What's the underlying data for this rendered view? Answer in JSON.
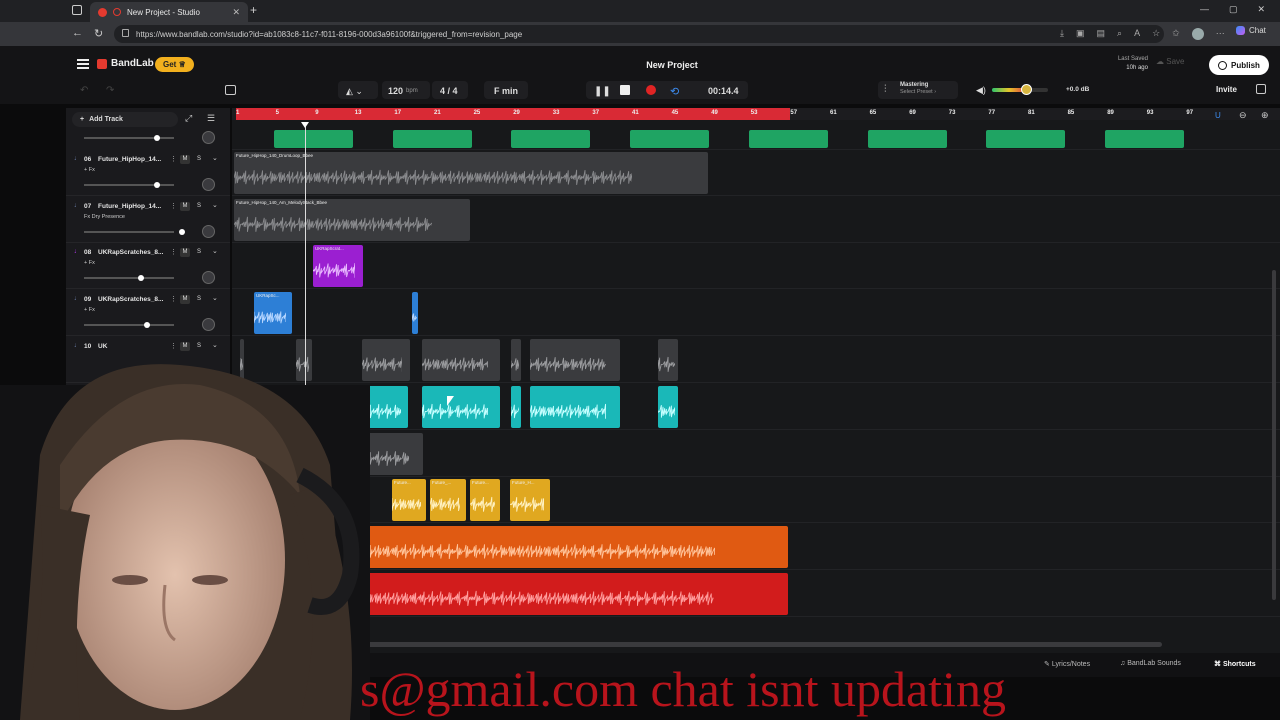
{
  "browser": {
    "tab_title": "New Project - Studio",
    "url": "https://www.bandlab.com/studio?id=ab1083c8-11c7-f011-8196-000d3a96100f&triggered_from=revision_page",
    "chat_label": "Chat"
  },
  "header": {
    "logo": "BandLab",
    "get_button": "Get",
    "project_title": "New Project",
    "last_saved_label": "Last Saved",
    "last_saved_time": "10h ago",
    "save_label": "Save",
    "publish_label": "Publish",
    "invite_label": "Invite"
  },
  "transport": {
    "bpm": "120",
    "bpm_unit": "bpm",
    "time_signature": "4 / 4",
    "key": "F min",
    "time": "00:14.4",
    "mastering_label": "Mastering",
    "mastering_preset": "Select Preset",
    "master_volume": "+0.0 dB",
    "volume_level": 0.6
  },
  "track_panel": {
    "add_track_label": "Add Track",
    "tracks": [
      {
        "number": "06",
        "name": "Future_HipHop_14...",
        "fx": "+ Fx",
        "mute": "M",
        "solo": "S"
      },
      {
        "number": "07",
        "name": "Future_HipHop_14...",
        "fx": "Fx Dry Presence",
        "mute": "M",
        "solo": "S"
      },
      {
        "number": "08",
        "name": "UKRapScratches_8...",
        "fx": "+ Fx",
        "mute": "M",
        "solo": "S"
      },
      {
        "number": "09",
        "name": "UKRapScratches_8...",
        "fx": "+ Fx",
        "mute": "M",
        "solo": "S"
      },
      {
        "number": "10",
        "name": "UK",
        "fx": "",
        "mute": "M",
        "solo": "S"
      }
    ]
  },
  "ruler": {
    "ticks": [
      "1",
      "5",
      "9",
      "13",
      "17",
      "21",
      "25",
      "29",
      "33",
      "37",
      "41",
      "45",
      "49",
      "53",
      "57",
      "61",
      "65",
      "69",
      "73",
      "77",
      "81",
      "85",
      "89",
      "93",
      "97"
    ]
  },
  "clips": {
    "lane1_name": "Future_HipHop_140_DrumLoop_Bbee",
    "lane2_name": "Future_HipHop_140_Am_MelodyStack_Bbee",
    "lane3_name": "UKRapScrat...",
    "lane4_name": "UKRapSc...",
    "lane8_names": [
      "Future...",
      "Future_...",
      "Future...",
      "Future_H..."
    ]
  },
  "bottom": {
    "lyrics_label": "Lyrics/Notes",
    "sounds_label": "BandLab Sounds",
    "shortcuts_label": "Shortcuts"
  },
  "stream_overlay": {
    "text": "s@gmail.com   chat isnt updating"
  },
  "colors": {
    "green_clip": "#1fa463",
    "purple_clip": "#9b1fd1",
    "blue_clip": "#2d7fd6",
    "teal_clip": "#1ab8b8",
    "yellow_clip": "#e0a820",
    "orange_clip": "#e05a12",
    "red_clip": "#d21c1c",
    "loop_bar": "#d92a35",
    "accent": "#f2b01e"
  }
}
